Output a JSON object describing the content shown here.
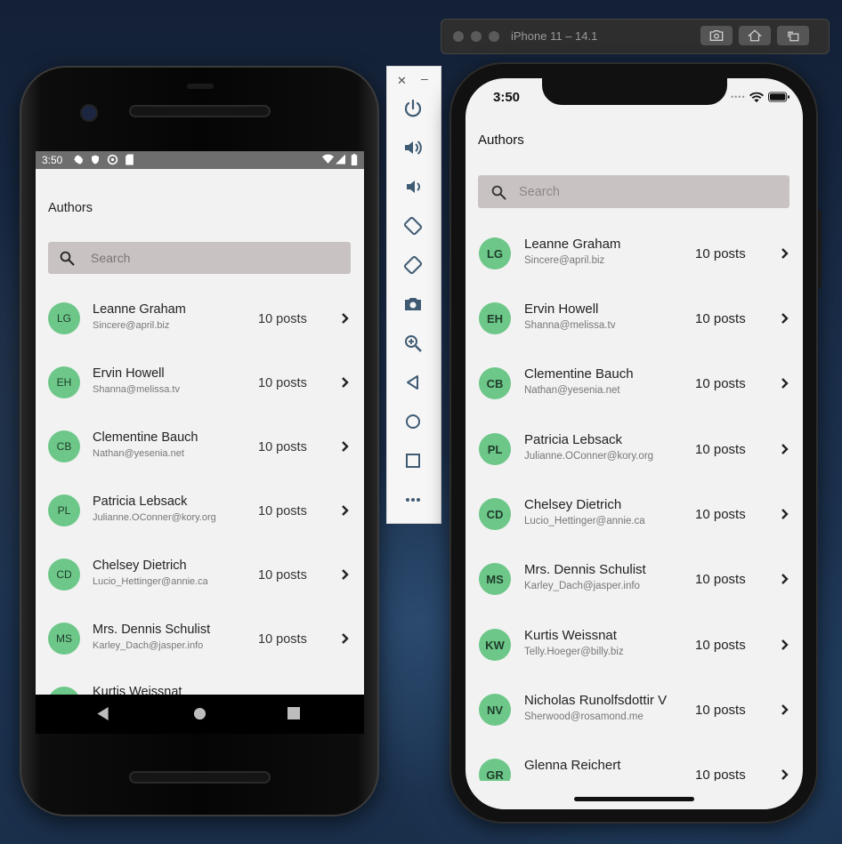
{
  "android": {
    "status_time": "3:50",
    "app_title": "Authors",
    "search_placeholder": "Search",
    "authors": [
      {
        "initials": "LG",
        "name": "Leanne Graham",
        "email": "Sincere@april.biz",
        "posts": "10 posts"
      },
      {
        "initials": "EH",
        "name": "Ervin Howell",
        "email": "Shanna@melissa.tv",
        "posts": "10 posts"
      },
      {
        "initials": "CB",
        "name": "Clementine Bauch",
        "email": "Nathan@yesenia.net",
        "posts": "10 posts"
      },
      {
        "initials": "PL",
        "name": "Patricia Lebsack",
        "email": "Julianne.OConner@kory.org",
        "posts": "10 posts"
      },
      {
        "initials": "CD",
        "name": "Chelsey Dietrich",
        "email": "Lucio_Hettinger@annie.ca",
        "posts": "10 posts"
      },
      {
        "initials": "MS",
        "name": "Mrs. Dennis Schulist",
        "email": "Karley_Dach@jasper.info",
        "posts": "10 posts"
      },
      {
        "initials": "",
        "name": "Kurtis Weissnat",
        "email": "",
        "posts": ""
      }
    ]
  },
  "ios": {
    "window_title": "iPhone 11 – 14.1",
    "status_time": "3:50",
    "app_title": "Authors",
    "search_placeholder": "Search",
    "authors": [
      {
        "initials": "LG",
        "name": "Leanne Graham",
        "email": "Sincere@april.biz",
        "posts": "10 posts"
      },
      {
        "initials": "EH",
        "name": "Ervin Howell",
        "email": "Shanna@melissa.tv",
        "posts": "10 posts"
      },
      {
        "initials": "CB",
        "name": "Clementine Bauch",
        "email": "Nathan@yesenia.net",
        "posts": "10 posts"
      },
      {
        "initials": "PL",
        "name": "Patricia Lebsack",
        "email": "Julianne.OConner@kory.org",
        "posts": "10 posts"
      },
      {
        "initials": "CD",
        "name": "Chelsey Dietrich",
        "email": "Lucio_Hettinger@annie.ca",
        "posts": "10 posts"
      },
      {
        "initials": "MS",
        "name": "Mrs. Dennis Schulist",
        "email": "Karley_Dach@jasper.info",
        "posts": "10 posts"
      },
      {
        "initials": "KW",
        "name": "Kurtis Weissnat",
        "email": "Telly.Hoeger@billy.biz",
        "posts": "10 posts"
      },
      {
        "initials": "NV",
        "name": "Nicholas Runolfsdottir V",
        "email": "Sherwood@rosamond.me",
        "posts": "10 posts"
      },
      {
        "initials": "GR",
        "name": "Glenna Reichert",
        "email": "",
        "posts": "10 posts"
      }
    ]
  },
  "colors": {
    "avatar": "#6cc788",
    "search_bar": "#c9c2c2",
    "screen_bg": "#f2f2f2"
  }
}
